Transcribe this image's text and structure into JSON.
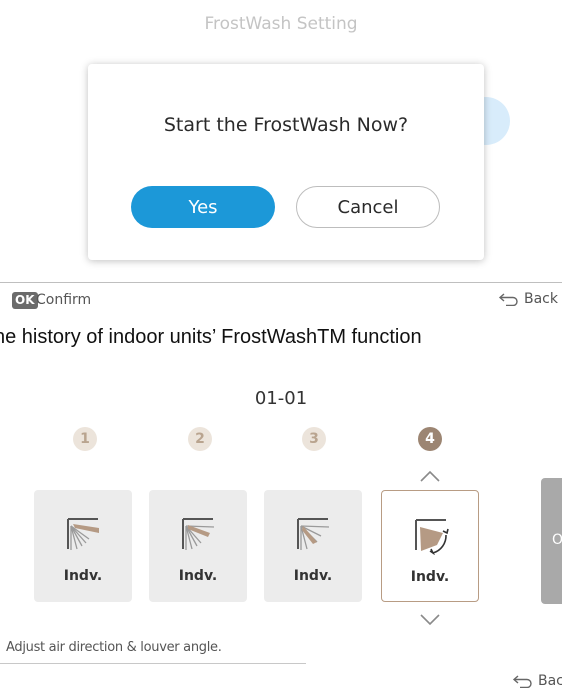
{
  "top_screen": {
    "title": "FrostWash Setting",
    "dialog": {
      "message": "Start the FrostWash Now?",
      "yes_label": "Yes",
      "cancel_label": "Cancel"
    },
    "footer": {
      "ok_badge": "OK",
      "confirm_label": "Confirm",
      "back_label": "Back"
    }
  },
  "caption": "he history of indoor units’ FrostWashTM function",
  "bottom_screen": {
    "unit_id": "01-01",
    "steps": [
      "1",
      "2",
      "3",
      "4"
    ],
    "active_step": 4,
    "cards": [
      {
        "label": "Indv.",
        "icon": "louver-fixed-icon"
      },
      {
        "label": "Indv.",
        "icon": "louver-fixed-icon"
      },
      {
        "label": "Indv.",
        "icon": "louver-fixed-icon"
      },
      {
        "label": "Indv.",
        "icon": "louver-swing-icon"
      }
    ],
    "side_card_text": "O",
    "hint": "Adjust air direction & louver angle.",
    "back_label": "Back",
    "colors": {
      "accent_blue": "#1c98d8",
      "step_active": "#9c8572",
      "step_done_bg": "#ece4db",
      "selected_border": "#b89c84"
    }
  }
}
